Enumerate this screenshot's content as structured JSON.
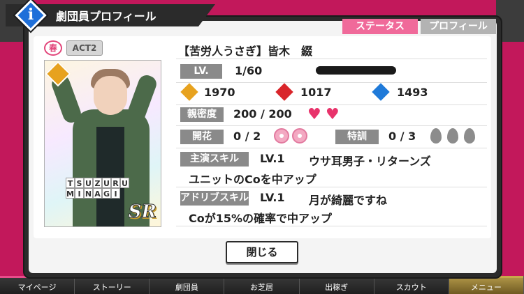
{
  "header": {
    "title": "劇団員プロフィール",
    "info_glyph": "i"
  },
  "tabs": [
    {
      "label": "ステータス",
      "active": true
    },
    {
      "label": "プロフィール",
      "active": false
    }
  ],
  "card": {
    "season": "春",
    "act": "ACT2",
    "name_row1": [
      "T",
      "S",
      "U",
      "Z",
      "U",
      "R",
      "U"
    ],
    "name_row2": [
      "M",
      "I",
      "N",
      "A",
      "G",
      "I",
      ""
    ],
    "rarity": "SR"
  },
  "character": {
    "name": "【苦労人うさぎ】皆木　綴"
  },
  "status": {
    "level_label": "LV.",
    "level_value": "1/60",
    "stat1": "1970",
    "stat2": "1017",
    "stat3": "1493",
    "intimacy_label": "親密度",
    "intimacy_value": "200 / 200",
    "bloom_label": "開花",
    "bloom_value": "0 / 2",
    "training_label": "特訓",
    "training_value": "0 / 3",
    "lead_skill_label": "主演スキル",
    "lead_skill_level": "LV.1",
    "lead_skill_name": "ウサ耳男子・リターンズ",
    "lead_skill_desc": "ユニットのCoを中アップ",
    "adlib_skill_label": "アドリブスキル",
    "adlib_skill_level": "LV.1",
    "adlib_skill_name": "月が綺麗ですね",
    "adlib_skill_desc": "Coが15%の確率で中アップ"
  },
  "close_label": "閉じる",
  "bottom_nav": [
    {
      "label": "マイページ",
      "color": "#e94c8b"
    },
    {
      "label": "ストーリー",
      "color": "#f08a2a"
    },
    {
      "label": "劇団員",
      "color": "#3aa34a"
    },
    {
      "label": "お芝居",
      "color": "#e8c22a"
    },
    {
      "label": "出稼ぎ",
      "color": "#3a7fd4"
    },
    {
      "label": "スカウト",
      "color": "#8a4fc8"
    },
    {
      "label": "メニュー",
      "color": "#c8a84a"
    }
  ],
  "colors": {
    "comedy": "#e7a21f",
    "action": "#d9252a",
    "cool": "#1f7ad9",
    "accent": "#f06a9a"
  }
}
